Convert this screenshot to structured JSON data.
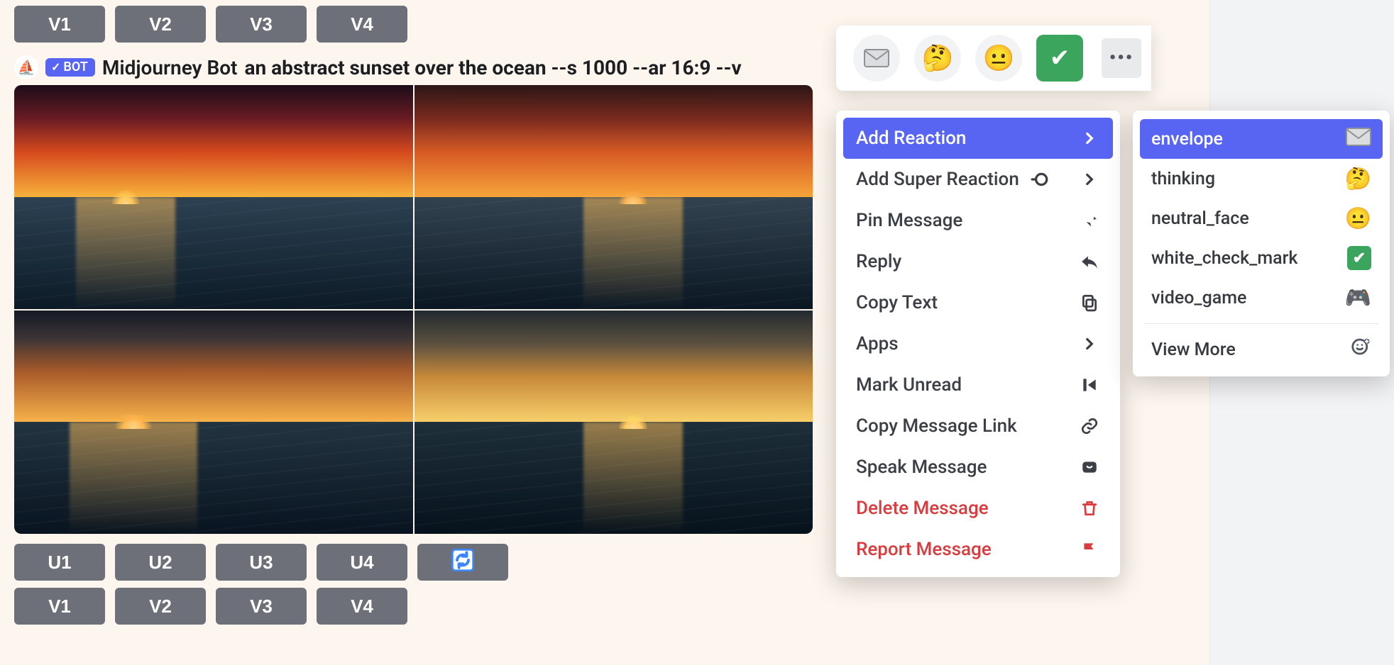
{
  "top_buttons": {
    "v1": "V1",
    "v2": "V2",
    "v3": "V3",
    "v4": "V4"
  },
  "message": {
    "bot_badge": "BOT",
    "author": "Midjourney Bot",
    "prompt": "an abstract sunset over the ocean --s 1000 --ar 16:9 --v"
  },
  "bottom_buttons_u": {
    "u1": "U1",
    "u2": "U2",
    "u3": "U3",
    "u4": "U4"
  },
  "bottom_buttons_v": {
    "v1": "V1",
    "v2": "V2",
    "v3": "V3",
    "v4": "V4"
  },
  "quick_reactions": {
    "envelope": "envelope",
    "thinking": "thinking",
    "neutral": "neutral_face",
    "check": "white_check_mark"
  },
  "context_menu": {
    "add_reaction": "Add Reaction",
    "add_super_reaction": "Add Super Reaction",
    "pin_message": "Pin Message",
    "reply": "Reply",
    "copy_text": "Copy Text",
    "apps": "Apps",
    "mark_unread": "Mark Unread",
    "copy_link": "Copy Message Link",
    "speak": "Speak Message",
    "delete": "Delete Message",
    "report": "Report Message"
  },
  "reaction_submenu": {
    "envelope": "envelope",
    "thinking": "thinking",
    "neutral_face": "neutral_face",
    "white_check_mark": "white_check_mark",
    "video_game": "video_game",
    "view_more": "View More"
  }
}
